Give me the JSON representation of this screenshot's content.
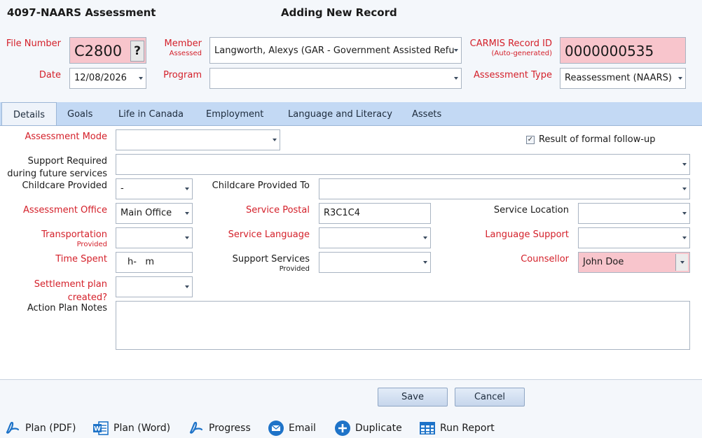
{
  "header": {
    "app_title": "4097-NAARS Assessment",
    "mode_title": "Adding New Record"
  },
  "top": {
    "file_number_label": "File Number",
    "file_number_value": "C2800",
    "help_button": "?",
    "date_label": "Date",
    "date_value": "12/08/2026",
    "member_label": "Member",
    "member_sub": "Assessed",
    "member_value": "Langworth, Alexys (GAR - Government Assisted Refu",
    "program_label": "Program",
    "program_value": "",
    "carmis_label": "CARMIS Record ID",
    "carmis_sub": "(Auto-generated)",
    "carmis_value": "0000000535",
    "assessment_type_label": "Assessment Type",
    "assessment_type_value": "Reassessment (NAARS)"
  },
  "tabs": [
    "Details",
    "Goals",
    "Life in Canada",
    "Employment",
    "Language and Literacy",
    "Assets"
  ],
  "details": {
    "assessment_mode_label": "Assessment Mode",
    "formal_followup_label": "Result of formal follow-up",
    "formal_followup_checked": "✓",
    "support_required_label": "Support Required",
    "support_required_sub": "during future services",
    "childcare_provided_label": "Childcare Provided",
    "childcare_provided_value": "-",
    "childcare_to_label": "Childcare Provided To",
    "assessment_office_label": "Assessment Office",
    "assessment_office_value": "Main Office",
    "service_postal_label": "Service Postal",
    "service_postal_value": "R3C1C4",
    "service_location_label": "Service Location",
    "transportation_label": "Transportation",
    "transportation_sub": "Provided",
    "service_language_label": "Service Language",
    "language_support_label": "Language Support",
    "time_spent_label": "Time Spent",
    "time_spent_value": "h-   m",
    "support_services_label": "Support Services",
    "support_services_sub": "Provided",
    "counsellor_label": "Counsellor",
    "counsellor_value": "John Doe",
    "settlement_plan_label": "Settlement plan",
    "settlement_plan_sub": "created?",
    "action_plan_label": "Action Plan Notes"
  },
  "buttons": {
    "save": "Save",
    "cancel": "Cancel"
  },
  "toolbar": {
    "plan_pdf": "Plan (PDF)",
    "plan_word": "Plan (Word)",
    "progress": "Progress",
    "email": "Email",
    "duplicate": "Duplicate",
    "run_report": "Run Report"
  },
  "colors": {
    "required": "#d4202a",
    "highlight": "#f8c5cc",
    "tab_bar": "#c3d9f4",
    "accent": "#1e73c8"
  }
}
